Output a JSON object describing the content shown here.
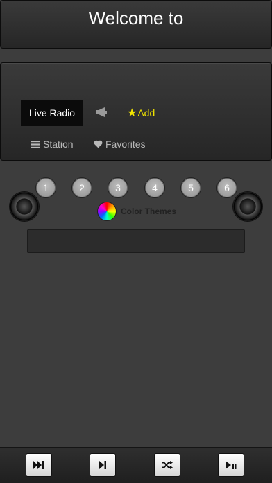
{
  "header": {
    "title": "Welcome to"
  },
  "tabs": {
    "live_radio": "Live Radio",
    "add": "Add",
    "station": "Station",
    "favorites": "Favorites"
  },
  "presets": [
    "1",
    "2",
    "3",
    "4",
    "5",
    "6"
  ],
  "color_themes": {
    "label": "Color Themes"
  },
  "controls": {
    "icons": [
      "fast-forward-icon",
      "skip-forward-icon",
      "shuffle-icon",
      "play-pause-icon"
    ]
  },
  "colors": {
    "background": "#3d3d3d",
    "add_accent": "#f2e600",
    "control_button": "#ffffff"
  }
}
